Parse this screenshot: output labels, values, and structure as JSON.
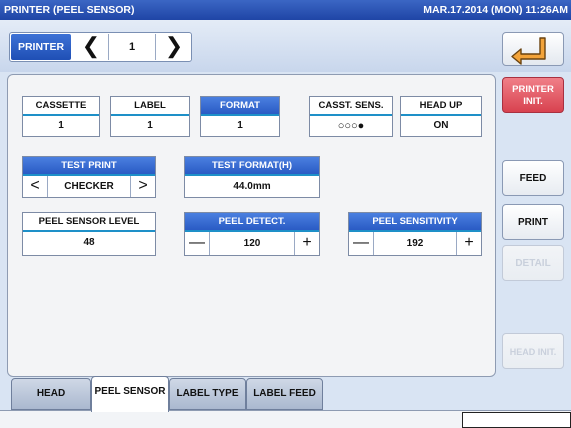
{
  "title_bar": {
    "title": "PRINTER (PEEL SENSOR)",
    "datetime": "MAR.17.2014 (MON) 11:26AM"
  },
  "printer_selector": {
    "label": "PRINTER",
    "prev_glyph": "❮",
    "value": "1",
    "next_glyph": "❯"
  },
  "fields": {
    "cassette": {
      "label": "CASSETTE",
      "value": "1"
    },
    "label": {
      "label": "LABEL",
      "value": "1"
    },
    "format": {
      "label": "FORMAT",
      "value": "1"
    },
    "casst_sens": {
      "label": "CASST. SENS.",
      "value": "○○○●"
    },
    "head_up": {
      "label": "HEAD UP",
      "value": "ON"
    },
    "test_print": {
      "label": "TEST PRINT",
      "value": "CHECKER"
    },
    "test_format": {
      "label": "TEST FORMAT(H)",
      "value": "44.0mm"
    },
    "peel_sensor_level": {
      "label": "PEEL SENSOR LEVEL",
      "value": "48"
    },
    "peel_detect": {
      "label": "PEEL DETECT.",
      "value": "120"
    },
    "peel_sensitivity": {
      "label": "PEEL SENSITIVITY",
      "value": "192"
    }
  },
  "stepper_glyphs": {
    "minus": "—",
    "plus": "+",
    "prev": "<",
    "next": ">"
  },
  "right_buttons": {
    "printer_init": "PRINTER INIT.",
    "feed": "FEED",
    "print": "PRINT",
    "detail": "DETAIL",
    "head_init": "HEAD INIT."
  },
  "tabs": [
    "HEAD",
    "PEEL SENSOR",
    "LABEL TYPE",
    "LABEL FEED"
  ],
  "active_tab": "PEEL SENSOR",
  "colors": {
    "accent_blue": "#2a5bc4",
    "title_bar": "#1f45a6",
    "init_red": "#d8424f",
    "underline": "#1e90c8"
  },
  "icons": {
    "back": "return-arrow-icon"
  }
}
